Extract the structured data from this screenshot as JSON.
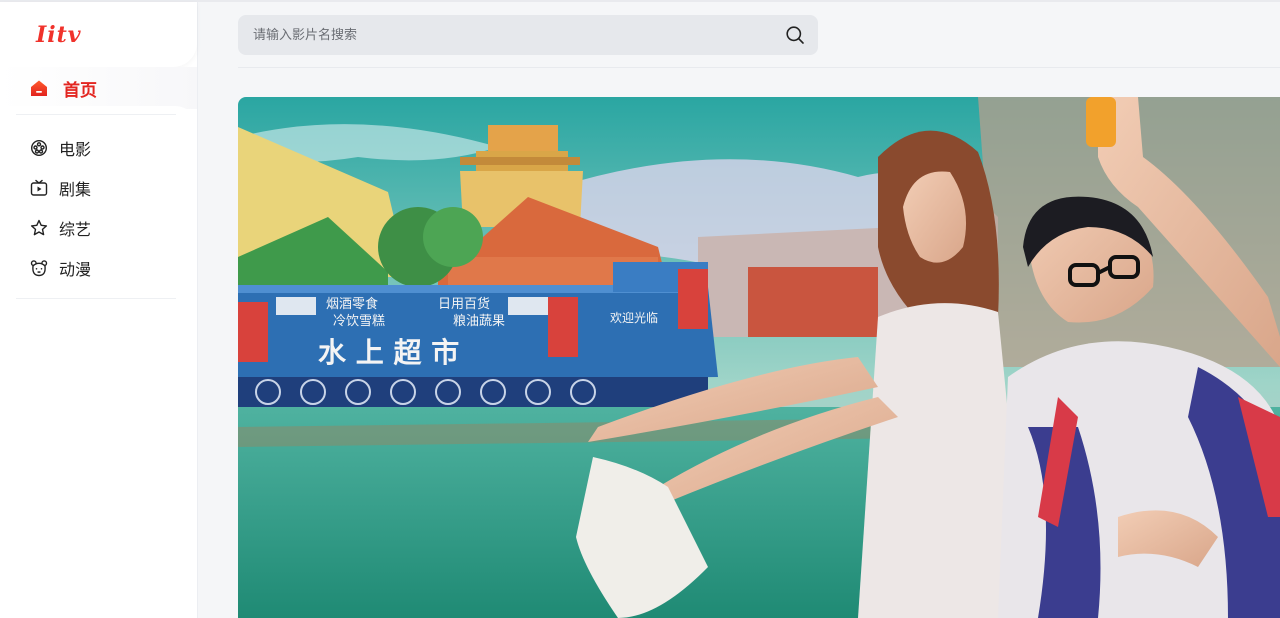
{
  "brand": {
    "logo_text": "Iitv",
    "accent": "#e32621"
  },
  "sidebar": {
    "home": {
      "label": "首页",
      "icon": "home-icon",
      "active": true
    },
    "items": [
      {
        "key": "movie",
        "label": "电影",
        "icon": "film-reel-icon"
      },
      {
        "key": "series",
        "label": "剧集",
        "icon": "tv-icon"
      },
      {
        "key": "variety",
        "label": "综艺",
        "icon": "star-icon"
      },
      {
        "key": "anime",
        "label": "动漫",
        "icon": "bear-face-icon"
      }
    ]
  },
  "header": {
    "search": {
      "placeholder": "请输入影片名搜索",
      "value": "",
      "icon": "search-icon"
    }
  },
  "banner": {
    "image_text": [
      "烟酒零食",
      "冷饮雪糕",
      "日用百货",
      "粮油蔬果",
      "欢迎光临",
      "水 上 超 市"
    ]
  }
}
